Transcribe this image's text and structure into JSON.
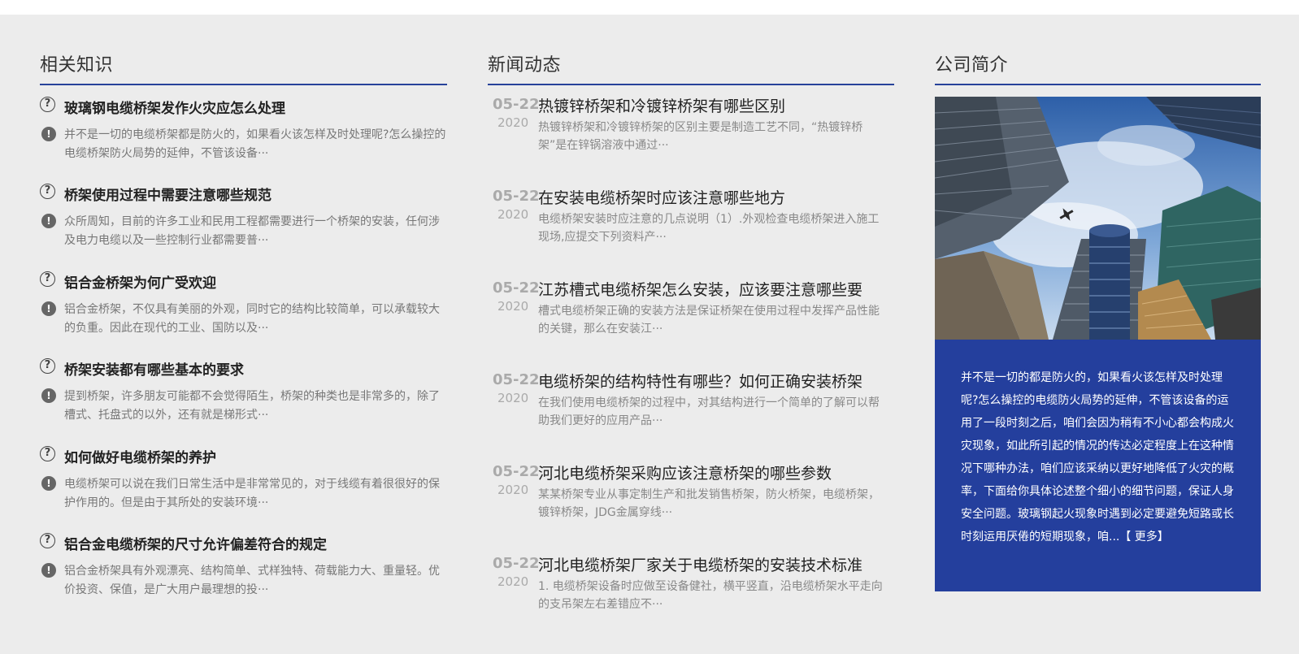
{
  "knowledge": {
    "title": "相关知识",
    "items": [
      {
        "title": "玻璃钢电缆桥架发作火灾应怎么处理",
        "desc": "并不是一切的电缆桥架都是防火的，如果看火该怎样及时处理呢?怎么操控的电缆桥架防火局势的延伸，不管该设备···"
      },
      {
        "title": "桥架使用过程中需要注意哪些规范",
        "desc": "众所周知，目前的许多工业和民用工程都需要进行一个桥架的安装，任何涉及电力电缆以及一些控制行业都需要普···"
      },
      {
        "title": "铝合金桥架为何广受欢迎",
        "desc": "铝合金桥架，不仅具有美丽的外观，同时它的结构比较简单，可以承载较大的负重。因此在现代的工业、国防以及···"
      },
      {
        "title": "桥架安装都有哪些基本的要求",
        "desc": "提到桥架，许多朋友可能都不会觉得陌生，桥架的种类也是非常多的，除了槽式、托盘式的以外，还有就是梯形式···"
      },
      {
        "title": "如何做好电缆桥架的养护",
        "desc": "电缆桥架可以说在我们日常生活中是非常常见的，对于线缆有着很很好的保护作用的。但是由于其所处的安装环境···"
      },
      {
        "title": "铝合金电缆桥架的尺寸允许偏差符合的规定",
        "desc": "铝合金桥架具有外观漂亮、结构简单、式样独特、荷载能力大、重量轻。优价投资、保值，是广大用户最理想的投···"
      }
    ]
  },
  "news": {
    "title": "新闻动态",
    "items": [
      {
        "day": "05-22",
        "year": "2020",
        "title": "热镀锌桥架和冷镀锌桥架有哪些区别",
        "desc": "热镀锌桥架和冷镀锌桥架的区别主要是制造工艺不同，“热镀锌桥架”是在锌锅溶液中通过···"
      },
      {
        "day": "05-22",
        "year": "2020",
        "title": "在安装电缆桥架时应该注意哪些地方",
        "desc": "电缆桥架安装时应注意的几点说明（1）.外观检查电缆桥架进入施工现场,应提交下列资料产···"
      },
      {
        "day": "05-22",
        "year": "2020",
        "title": "江苏槽式电缆桥架怎么安装，应该要注意哪些要",
        "desc": "槽式电缆桥架正确的安装方法是保证桥架在使用过程中发挥产品性能的关键，那么在安装江···"
      },
      {
        "day": "05-22",
        "year": "2020",
        "title": "电缆桥架的结构特性有哪些？如何正确安装桥架",
        "desc": "在我们使用电缆桥架的过程中，对其结构进行一个简单的了解可以帮助我们更好的应用产品···"
      },
      {
        "day": "05-22",
        "year": "2020",
        "title": "河北电缆桥架采购应该注意桥架的哪些参数",
        "desc": "某某桥架专业从事定制生产和批发销售桥架，防火桥架，电缆桥架，镀锌桥架，JDG金属穿线···"
      },
      {
        "day": "05-22",
        "year": "2020",
        "title": "河北电缆桥架厂家关于电缆桥架的安装技术标准",
        "desc": "1. 电缆桥架设备时应做至设备健社，横平竖直，沿电缆桥架水平走向的支吊架左右差错应不···"
      }
    ]
  },
  "about": {
    "title": "公司简介",
    "text": "并不是一切的都是防火的，如果看火该怎样及时处理呢?怎么操控的电缆防火局势的延伸，不管该设备的运用了一段时刻之后，咱们会因为稍有不小心都会构成火灾现象，如此所引起的情况的传达必定程度上在这种情况下哪种办法，咱们应该采纳以更好地降低了火灾的概率，下面给你具体论述整个细小的细节问题，保证人身安全问题。玻璃钢起火现象时遇到必定要避免短路或长时刻运用厌倦的短期现象，咱...",
    "more": "【 更多】"
  },
  "colors": {
    "accent": "#243f9d",
    "background": "#ececec"
  }
}
